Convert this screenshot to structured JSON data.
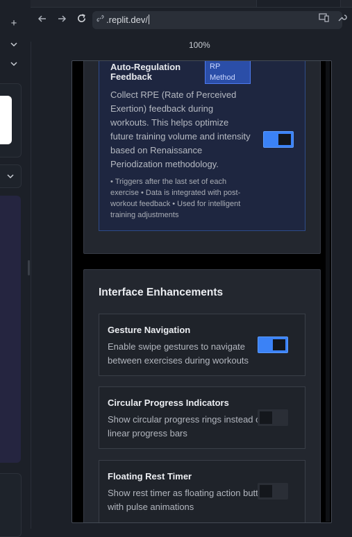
{
  "browser": {
    "url": ".replit.dev/",
    "zoom": "100%"
  },
  "sidebar": {
    "plus": "+",
    "chevron": "⌄"
  },
  "settings": {
    "rp_feedback": {
      "title": "Auto-Regulation Feedback",
      "badge": "RP Method",
      "description": "Collect RPE (Rate of Perceived Exertion) feedback during workouts. This helps optimize future training volume and intensity based on Renaissance Periodization methodology.",
      "notes": "• Triggers after the last set of each exercise • Data is integrated with post-workout feedback • Used for intelligent training adjustments",
      "enabled": true
    },
    "interface_section": {
      "title": "Interface Enhancements",
      "items": [
        {
          "title": "Gesture Navigation",
          "description": "Enable swipe gestures to navigate between exercises during workouts",
          "enabled": true
        },
        {
          "title": "Circular Progress Indicators",
          "description": "Show circular progress rings instead of linear progress bars",
          "enabled": false
        },
        {
          "title": "Floating Rest Timer",
          "description": "Show rest timer as floating action button with pulse animations",
          "enabled": false
        }
      ]
    }
  },
  "colors": {
    "accent": "#3b82f6",
    "badge_bg": "#2b4ea8"
  },
  "icons": {
    "back": "arrow-left-icon",
    "forward": "arrow-right-icon",
    "reload": "reload-icon",
    "link": "link-icon",
    "devices": "devices-icon",
    "devtools": "wrench-icon"
  }
}
